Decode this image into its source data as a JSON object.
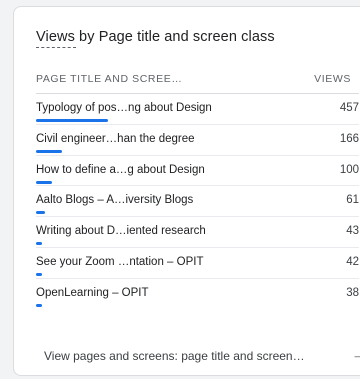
{
  "card": {
    "title": "Views by Page title and screen class",
    "columns": {
      "left": "PAGE TITLE AND SCREE…",
      "right": "VIEWS"
    },
    "rows": [
      {
        "label": "Typology of pos…ng about Design",
        "value": "457",
        "share": 1.0
      },
      {
        "label": "Civil engineer…han the degree",
        "value": "166",
        "share": 0.36
      },
      {
        "label": "How to define a…g about Design",
        "value": "100",
        "share": 0.22
      },
      {
        "label": "Aalto Blogs – A…iversity Blogs",
        "value": "61",
        "share": 0.13
      },
      {
        "label": "Writing about D…iented research",
        "value": "43",
        "share": 0.09
      },
      {
        "label": "See your Zoom …ntation – OPIT",
        "value": "42",
        "share": 0.09
      },
      {
        "label": "OpenLearning – OPIT",
        "value": "38",
        "share": 0.08
      }
    ],
    "footer_link": "View pages and screens: page title and screen…",
    "footer_icon": "arrow-right-icon",
    "bar_color": "#1a73e8"
  }
}
